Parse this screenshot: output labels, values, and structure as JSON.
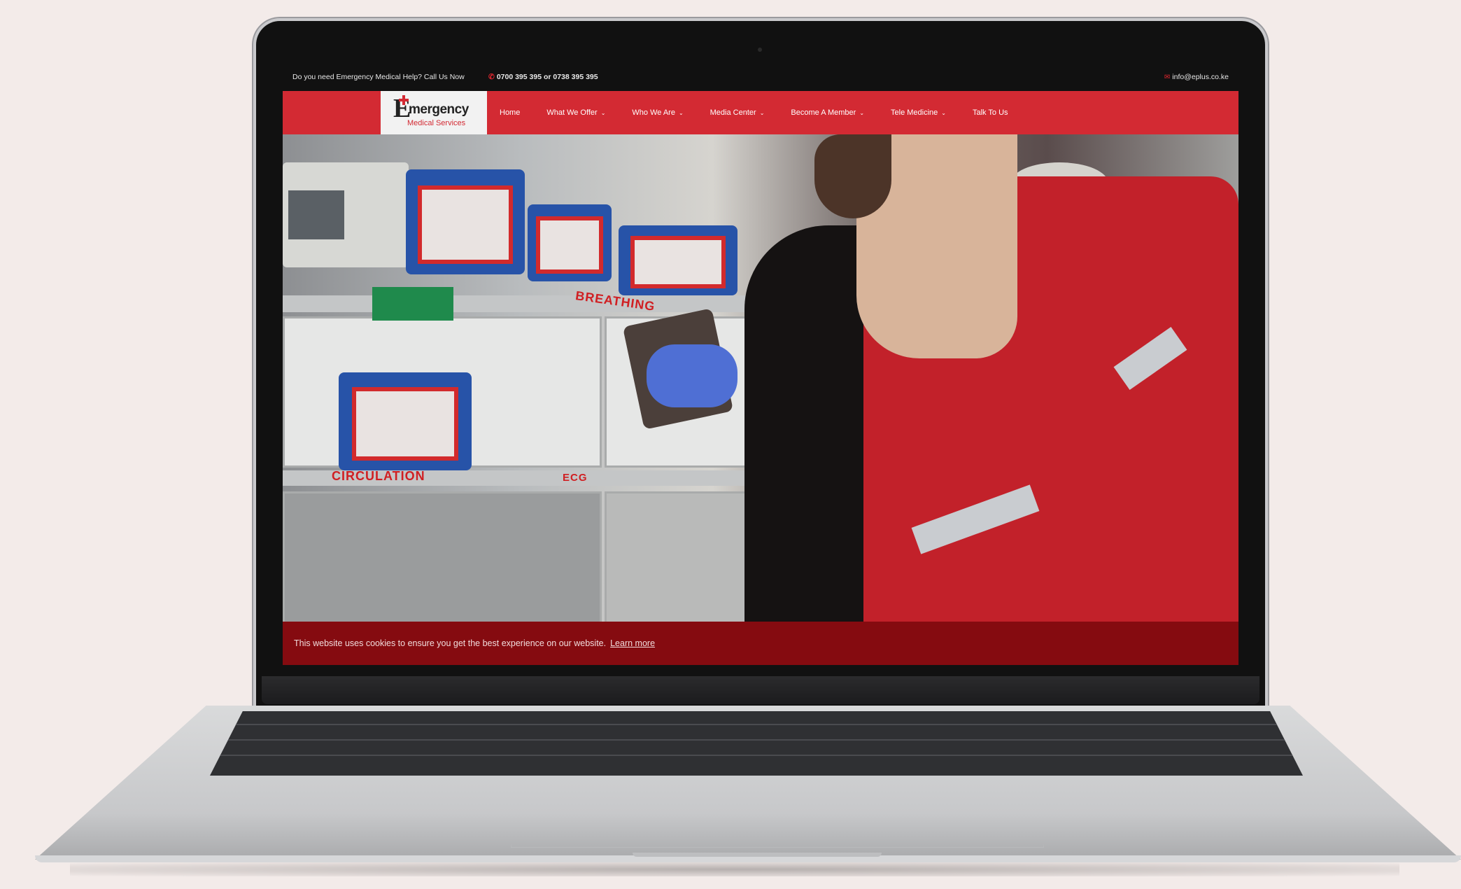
{
  "topbar": {
    "help_text": "Do you need Emergency Medical Help? Call Us Now",
    "phone": "0700 395 395 or 0738 395 395",
    "email": "info@eplus.co.ke",
    "phone_icon": "phone-icon",
    "email_icon": "mail-icon"
  },
  "logo": {
    "letter": "E",
    "word": "mergency",
    "subtitle": "Medical Services"
  },
  "nav": {
    "items": [
      {
        "label": "Home",
        "has_dropdown": false
      },
      {
        "label": "What We Offer",
        "has_dropdown": true
      },
      {
        "label": "Who We Are",
        "has_dropdown": true
      },
      {
        "label": "Media Center",
        "has_dropdown": true
      },
      {
        "label": "Become A Member",
        "has_dropdown": true
      },
      {
        "label": "Tele Medicine",
        "has_dropdown": true
      },
      {
        "label": "Talk To Us",
        "has_dropdown": false
      }
    ],
    "chevron": "⌄"
  },
  "hero": {
    "labels": [
      "BREATHING",
      "CIRCULATION",
      "ECG"
    ]
  },
  "cookie": {
    "message": "This website uses cookies to ensure you get the best experience on our website.",
    "link": "Learn more"
  },
  "colors": {
    "brand_red": "#d32a33",
    "cookie_bg": "#850b10",
    "topbar_bg": "#111111"
  }
}
